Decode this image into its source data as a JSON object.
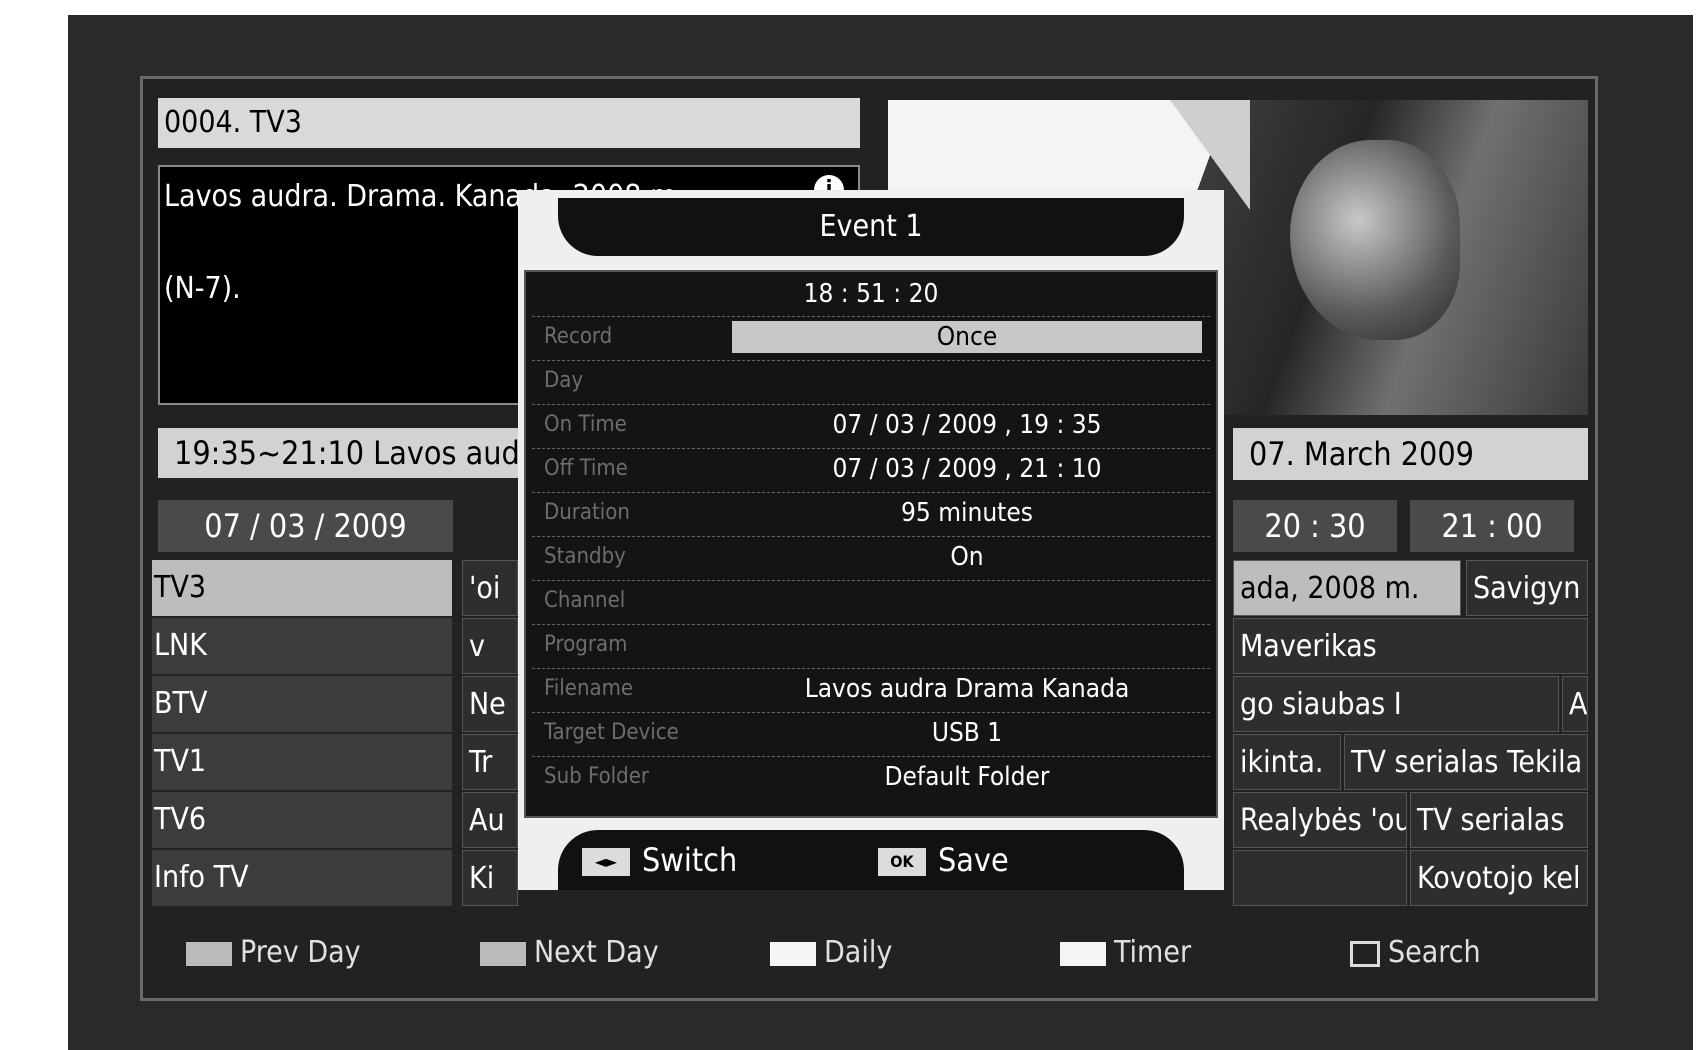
{
  "channel_header": "0004. TV3",
  "description": {
    "line1": "Lavos audra. Drama. Kanada, 2008 m.",
    "line2": "(N-7).",
    "info_icon": "info-icon"
  },
  "program_bar": "19:35~21:10 Lavos audra",
  "date_bar": "07. March 2009",
  "grid": {
    "date": "07 / 03 / 2009",
    "times": [
      "20 : 30",
      "21 : 00"
    ],
    "channels": [
      {
        "name": "TV3",
        "left_cell": "'oi",
        "right_a": "ada, 2008 m.",
        "right_b": "Savigyn"
      },
      {
        "name": "LNK",
        "left_cell": "v",
        "right_a": "Maverikas",
        "right_b": ""
      },
      {
        "name": "BTV",
        "left_cell": "Ne",
        "right_a": "go siaubas I",
        "right_b": "A"
      },
      {
        "name": "TV1",
        "left_cell": "Tr",
        "right_a": "ikinta.",
        "right_b": "TV serialas Tekila"
      },
      {
        "name": "TV6",
        "left_cell": "Au",
        "right_a": "Realybės 'ou",
        "right_b": "TV serialas"
      },
      {
        "name": "Info TV",
        "left_cell": "Ki",
        "right_a": "",
        "right_b": "Kovotojo kel"
      }
    ]
  },
  "footer": {
    "prev_day": "Prev Day",
    "next_day": "Next Day",
    "daily": "Daily",
    "timer": "Timer",
    "search": "Search"
  },
  "modal": {
    "title": "Event 1",
    "time": "18 : 51 : 20",
    "rows": [
      {
        "label": "Record",
        "value": "Once"
      },
      {
        "label": "Day",
        "value": ""
      },
      {
        "label": "On Time",
        "value": "07 / 03 / 2009 , 19 : 35"
      },
      {
        "label": "Off Time",
        "value": "07 / 03 / 2009 , 21 : 10"
      },
      {
        "label": "Duration",
        "value": "95 minutes"
      },
      {
        "label": "Standby",
        "value": "On"
      },
      {
        "label": "Channel",
        "value": ""
      },
      {
        "label": "Program",
        "value": ""
      },
      {
        "label": "Filename",
        "value": "Lavos audra Drama  Kanada"
      },
      {
        "label": "Target Device",
        "value": "USB 1"
      },
      {
        "label": "Sub Folder",
        "value": "Default Folder"
      }
    ],
    "switch_key": "◄►",
    "switch_label": "Switch",
    "save_key": "OK",
    "save_label": "Save"
  }
}
